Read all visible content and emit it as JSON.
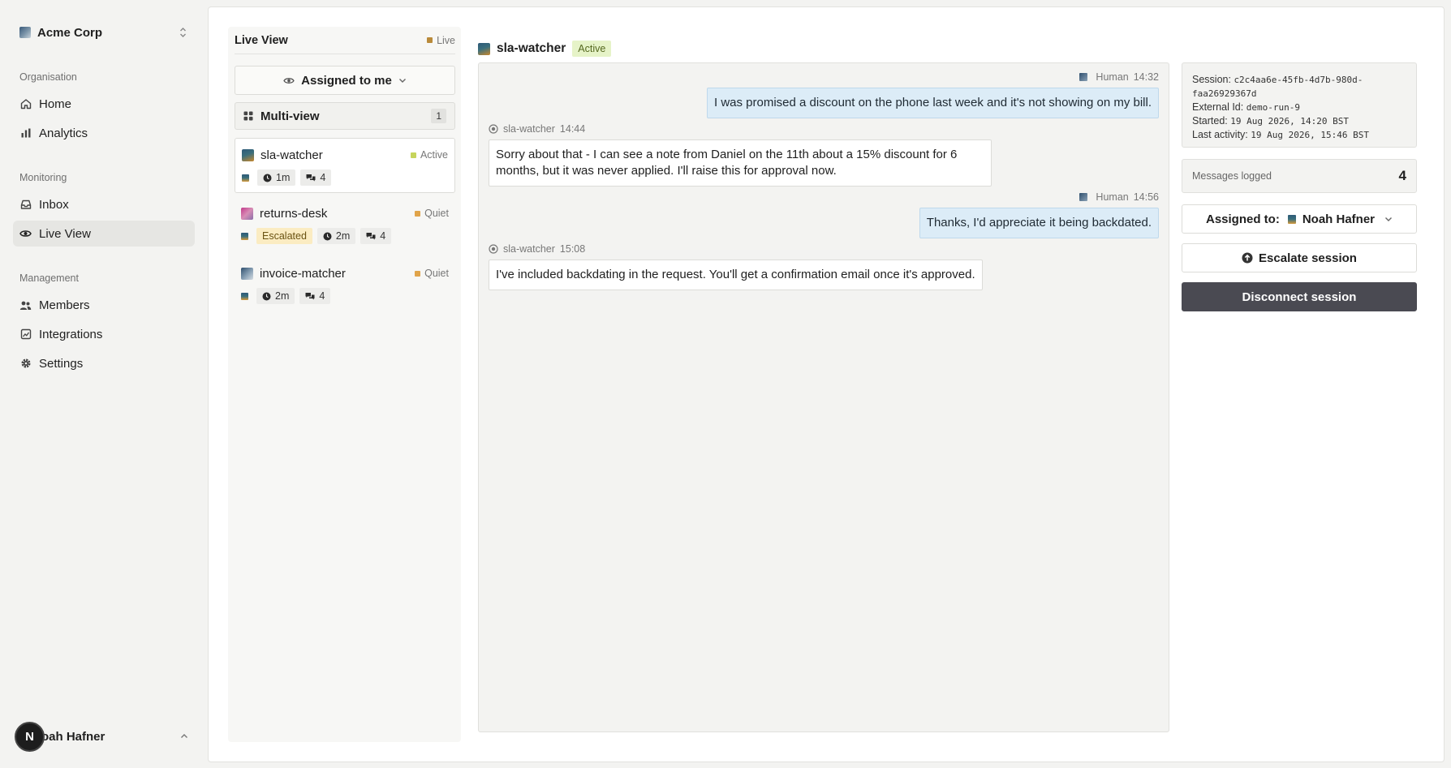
{
  "org": {
    "name": "Acme Corp"
  },
  "nav": {
    "sections": {
      "organisation": "Organisation",
      "monitoring": "Monitoring",
      "management": "Management"
    },
    "items": {
      "home": "Home",
      "analytics": "Analytics",
      "inbox": "Inbox",
      "live_view": "Live View",
      "members": "Members",
      "integrations": "Integrations",
      "settings": "Settings"
    },
    "active": "live_view"
  },
  "user": {
    "initial": "N",
    "name": "oah Hafner"
  },
  "live": {
    "title": "Live View",
    "tag": "Live",
    "filter": "Assigned to me",
    "multi_view": {
      "label": "Multi-view",
      "count": "1"
    },
    "agents": [
      {
        "name": "sla-watcher",
        "status": "Active",
        "time": "1m",
        "messages": "4",
        "escalated": false,
        "selected": true
      },
      {
        "name": "returns-desk",
        "status": "Quiet",
        "time": "2m",
        "messages": "4",
        "escalated": true,
        "escalated_label": "Escalated",
        "selected": false
      },
      {
        "name": "invoice-matcher",
        "status": "Quiet",
        "time": "2m",
        "messages": "4",
        "escalated": false,
        "selected": false
      }
    ]
  },
  "chat": {
    "agent": "sla-watcher",
    "status": "Active",
    "messages": [
      {
        "role": "Human",
        "time": "14:32",
        "text": "I was promised a discount on the phone last week and it's not showing on my bill."
      },
      {
        "role": "sla-watcher",
        "time": "14:44",
        "text": "Sorry about that - I can see a note from Daniel on the 11th about a 15% discount for 6 months, but it was never applied. I'll raise this for approval now."
      },
      {
        "role": "Human",
        "time": "14:56",
        "text": "Thanks, I'd appreciate it being backdated."
      },
      {
        "role": "sla-watcher",
        "time": "15:08",
        "text": "I've included backdating in the request. You'll get a confirmation email once it's approved."
      }
    ]
  },
  "session": {
    "session_label": "Session:",
    "session_id_1": "c2c4aa6e-45fb-4d7b-980d-",
    "session_id_2": "faa26929367d",
    "external_label": "External Id:",
    "external_id": "demo-run-9",
    "started_label": "Started:",
    "started": "19 Aug 2026, 14:20 BST",
    "last_label": "Last activity:",
    "last_activity": "19 Aug 2026, 15:46 BST",
    "messages_label": "Messages logged",
    "messages_count": "4",
    "assigned_label": "Assigned to:",
    "assigned_to": "Noah Hafner",
    "escalate": "Escalate session",
    "disconnect": "Disconnect session"
  },
  "colors": {
    "active_dot": "#c6d45c",
    "quiet_dot": "#e0a44a",
    "live_dot": "#b98a3a",
    "human_bubble": "#dcecf7",
    "disconnect_bg": "#4a4a52"
  }
}
